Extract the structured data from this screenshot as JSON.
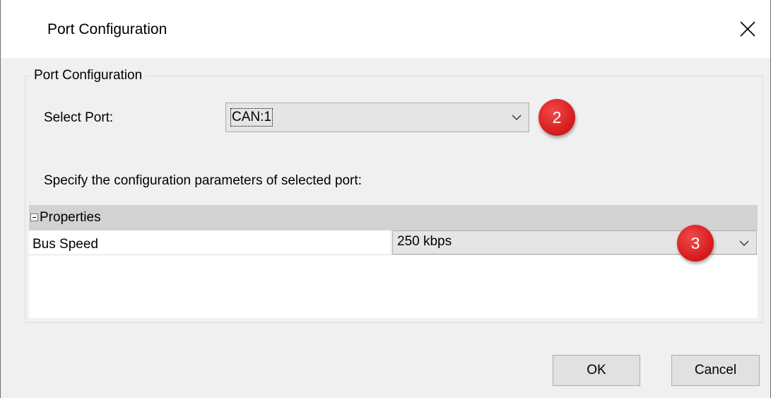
{
  "window": {
    "title": "Port Configuration",
    "close_icon": "close-icon"
  },
  "group": {
    "legend": "Port Configuration"
  },
  "select_port": {
    "label": "Select Port:",
    "value": "CAN:1",
    "badge": "2"
  },
  "instruction": "Specify the configuration parameters of selected port:",
  "properties": {
    "category": "Properties",
    "rows": [
      {
        "name": "Bus Speed",
        "value": "250 kbps",
        "badge": "3"
      }
    ]
  },
  "buttons": {
    "ok": "OK",
    "cancel": "Cancel"
  },
  "colors": {
    "badge": "#d91f1f",
    "dialog_bg": "#f0f0f0",
    "category_bg": "#d2d2d2"
  }
}
